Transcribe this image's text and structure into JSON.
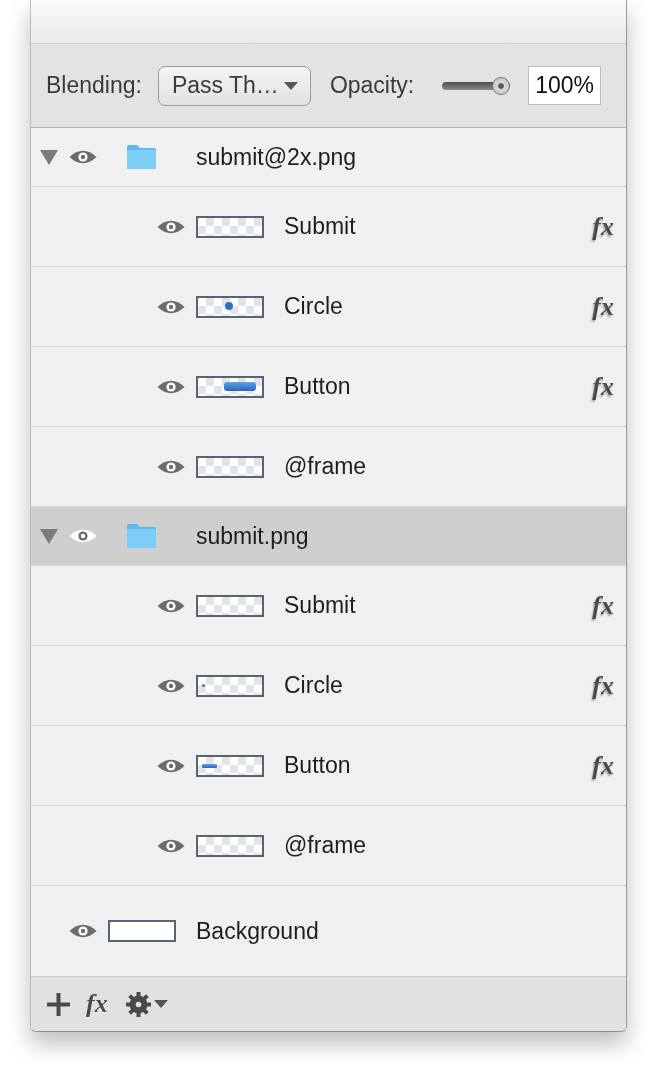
{
  "toolbar": {
    "blending_label": "Blending:",
    "blending_dropdown": {
      "value": "Pass Th…"
    },
    "opacity_label": "Opacity:",
    "opacity_slider": {
      "level": 1
    },
    "opacity_field": {
      "value": "100%"
    }
  },
  "layers": [
    {
      "name": "submit@2x.png",
      "kind": "group",
      "expanded": true,
      "visible": true,
      "selected": false,
      "children": [
        {
          "name": "Submit",
          "kind": "layer",
          "visible": true,
          "selected": false,
          "thumbnail": {
            "kind": "transparent"
          },
          "fx": "fx"
        },
        {
          "name": "Circle",
          "kind": "layer",
          "visible": true,
          "selected": false,
          "thumbnail": {
            "kind": "dot",
            "small": false
          },
          "fx": "fx"
        },
        {
          "name": "Button",
          "kind": "layer",
          "visible": true,
          "selected": false,
          "thumbnail": {
            "kind": "bar",
            "small": false
          },
          "fx": "fx"
        },
        {
          "name": "@frame",
          "kind": "layer",
          "visible": true,
          "selected": false,
          "thumbnail": {
            "kind": "transparent"
          }
        }
      ]
    },
    {
      "name": "submit.png",
      "kind": "group",
      "expanded": true,
      "visible": true,
      "selected": true,
      "children": [
        {
          "name": "Submit",
          "kind": "layer",
          "visible": true,
          "selected": false,
          "thumbnail": {
            "kind": "transparent"
          },
          "fx": "fx"
        },
        {
          "name": "Circle",
          "kind": "layer",
          "visible": true,
          "selected": false,
          "thumbnail": {
            "kind": "dot",
            "small": true
          },
          "fx": "fx"
        },
        {
          "name": "Button",
          "kind": "layer",
          "visible": true,
          "selected": false,
          "thumbnail": {
            "kind": "bar",
            "small": true
          },
          "fx": "fx"
        },
        {
          "name": "@frame",
          "kind": "layer",
          "visible": true,
          "selected": false,
          "thumbnail": {
            "kind": "transparent"
          }
        }
      ]
    },
    {
      "name": "Background",
      "kind": "layer",
      "visible": true,
      "selected": false,
      "thumbnail": {
        "kind": "solid"
      }
    }
  ],
  "footer": {
    "effects_button": "fx"
  }
}
